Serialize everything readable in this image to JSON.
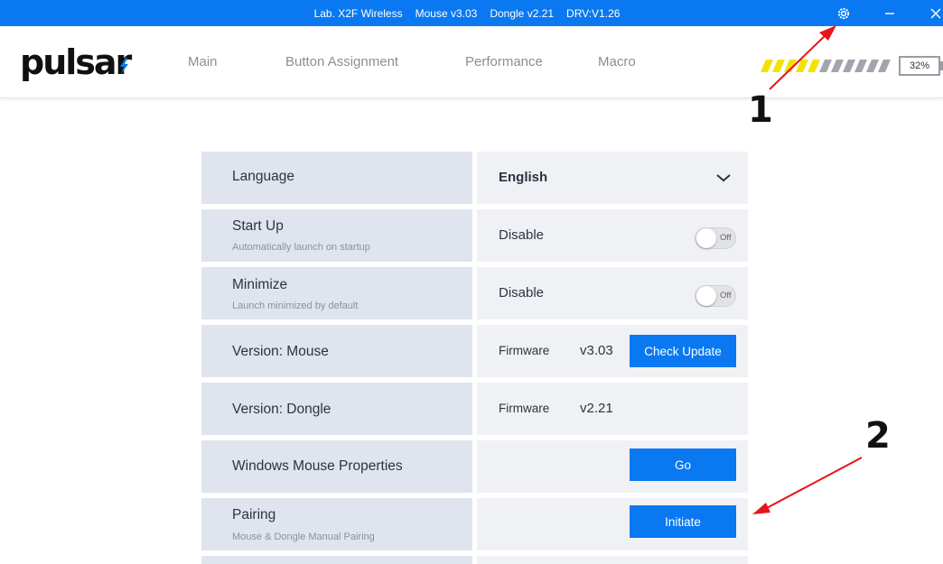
{
  "titlebar": {
    "device": "Lab. X2F Wireless",
    "mouse_version": "Mouse v3.03",
    "dongle_version": "Dongle v2.21",
    "driver_version": "DRV:V1.26"
  },
  "header": {
    "nav": [
      "Main",
      "Button Assignment",
      "Performance",
      "Macro"
    ],
    "battery_percent": "32%"
  },
  "settings": {
    "language": {
      "label": "Language",
      "value": "English"
    },
    "startup": {
      "label": "Start Up",
      "sublabel": "Automatically launch on startup",
      "value": "Disable",
      "toggle": "Off"
    },
    "minimize": {
      "label": "Minimize",
      "sublabel": "Launch minimized by default",
      "value": "Disable",
      "toggle": "Off"
    },
    "version_mouse": {
      "label": "Version: Mouse",
      "fw_label": "Firmware",
      "version": "v3.03",
      "button": "Check Update"
    },
    "version_dongle": {
      "label": "Version: Dongle",
      "fw_label": "Firmware",
      "version": "v2.21"
    },
    "windows_mouse": {
      "label": "Windows Mouse Properties",
      "button": "Go"
    },
    "pairing": {
      "label": "Pairing",
      "sublabel": "Mouse & Dongle Manual Pairing",
      "button": "Initiate"
    }
  },
  "annotations": {
    "marker1": "1",
    "marker2": "2"
  },
  "colors": {
    "accent": "#0a78f0",
    "annotation_arrow": "#e8141b"
  }
}
